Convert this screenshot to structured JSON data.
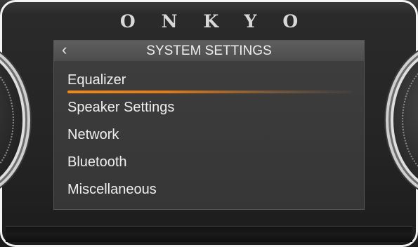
{
  "device": {
    "brand": "O N K Y O"
  },
  "screen": {
    "title": "SYSTEM SETTINGS",
    "back_icon": "chevron-left-icon",
    "menu_items": [
      {
        "label": "Equalizer",
        "selected": true
      },
      {
        "label": "Speaker Settings",
        "selected": false
      },
      {
        "label": "Network",
        "selected": false
      },
      {
        "label": "Bluetooth",
        "selected": false
      },
      {
        "label": "Miscellaneous",
        "selected": false
      }
    ]
  },
  "colors": {
    "accent": "#f08a1c",
    "background": "#2a2a2a",
    "titlebar": "#555555"
  }
}
